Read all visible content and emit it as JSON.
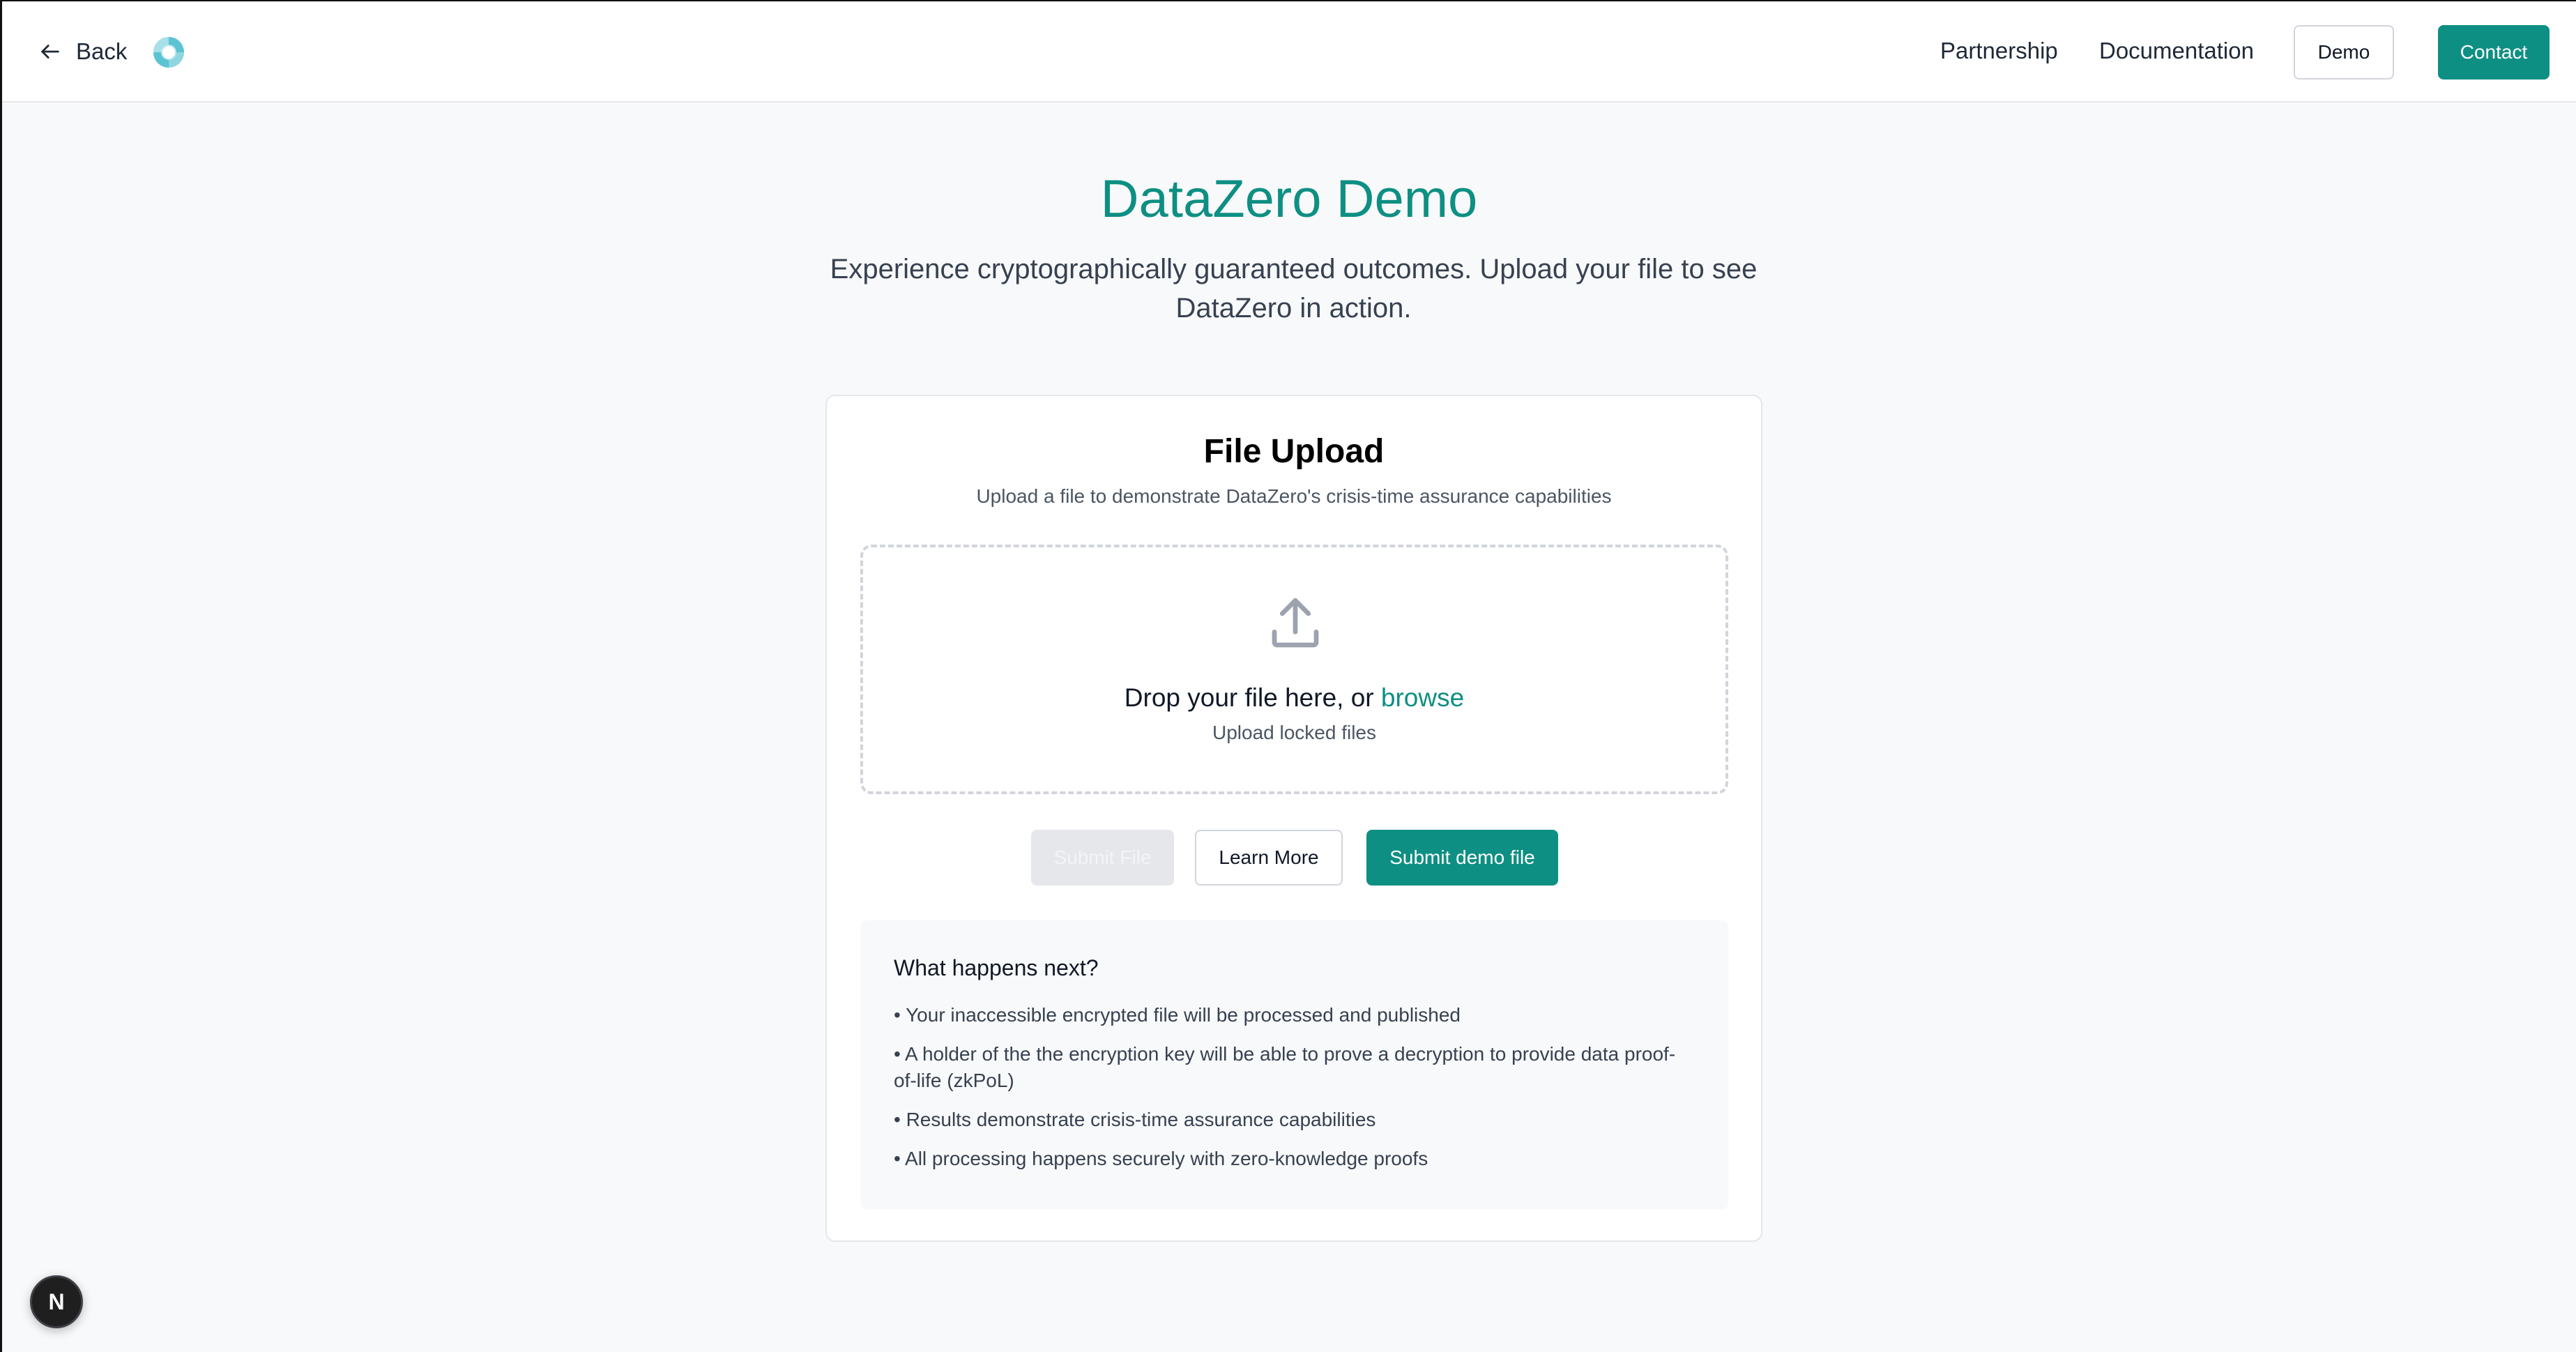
{
  "header": {
    "back_label": "Back",
    "nav": [
      "Partnership",
      "Documentation"
    ],
    "demo_label": "Demo",
    "contact_label": "Contact"
  },
  "hero": {
    "title": "DataZero Demo",
    "subtitle": "Experience cryptographically guaranteed outcomes. Upload your file to see DataZero in action."
  },
  "upload_card": {
    "title": "File Upload",
    "subtitle": "Upload a file to demonstrate DataZero's crisis-time assurance capabilities",
    "drop_text": "Drop your file here, or ",
    "browse_label": "browse",
    "drop_hint": "Upload locked files",
    "submit_label": "Submit File",
    "learn_more_label": "Learn More",
    "submit_demo_label": "Submit demo file"
  },
  "next_steps": {
    "title": "What happens next?",
    "items": [
      "• Your inaccessible encrypted file will be processed and published",
      "• A holder of the the encryption key will be able to prove a decryption to provide data proof-of-life (zkPoL)",
      "• Results demonstrate crisis-time assurance capabilities",
      "• All processing happens securely with zero-knowledge proofs"
    ]
  },
  "dev_badge": "N",
  "colors": {
    "accent": "#0e8f83",
    "background": "#f8f9fa",
    "disabled": "#e5e7eb"
  },
  "icons": [
    "arrow-left-icon",
    "logo-icon",
    "upload-icon"
  ]
}
